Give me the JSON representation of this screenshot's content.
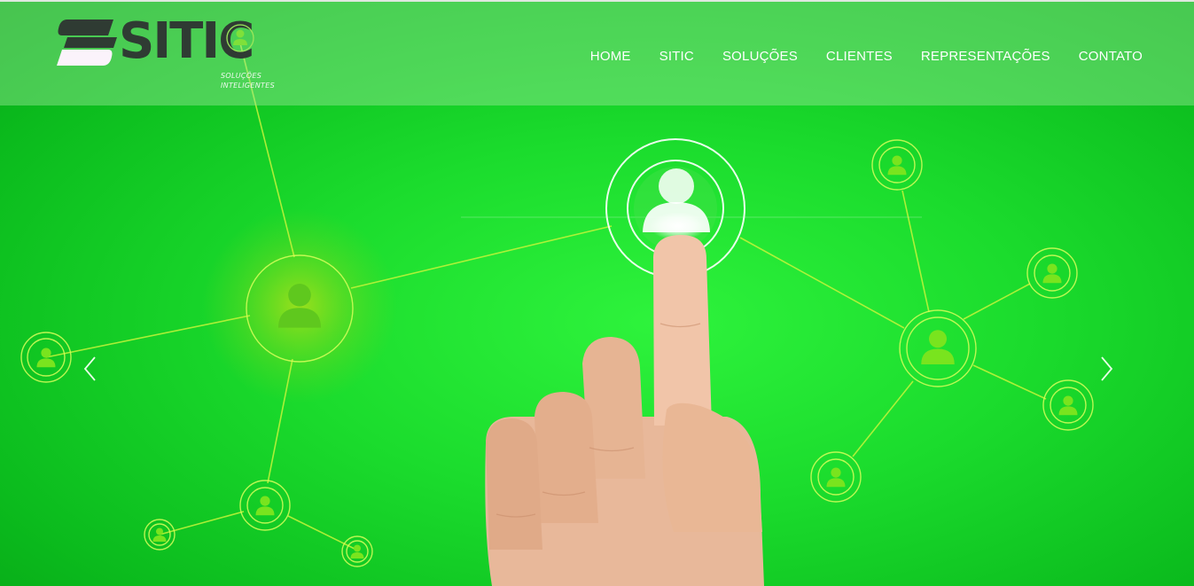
{
  "brand": {
    "name": "SITIC",
    "tagline_line1": "SOLUÇÕES",
    "tagline_line2": "INTELIGENTES"
  },
  "nav": {
    "items": [
      {
        "label": "HOME"
      },
      {
        "label": "SITIC"
      },
      {
        "label": "SOLUÇÕES"
      },
      {
        "label": "CLIENTES"
      },
      {
        "label": "REPRESENTAÇÕES"
      },
      {
        "label": "CONTATO"
      }
    ]
  },
  "hero": {
    "slide_image": "network-touch-hand",
    "icons": [
      "user-icon",
      "chevron-left-icon",
      "chevron-right-icon",
      "hand-icon"
    ]
  },
  "colors": {
    "hero_green": "#1bdc2d",
    "network_line": "#c6f53a",
    "nav_text": "#ffffff",
    "logo_dark": "#2f3b33"
  }
}
